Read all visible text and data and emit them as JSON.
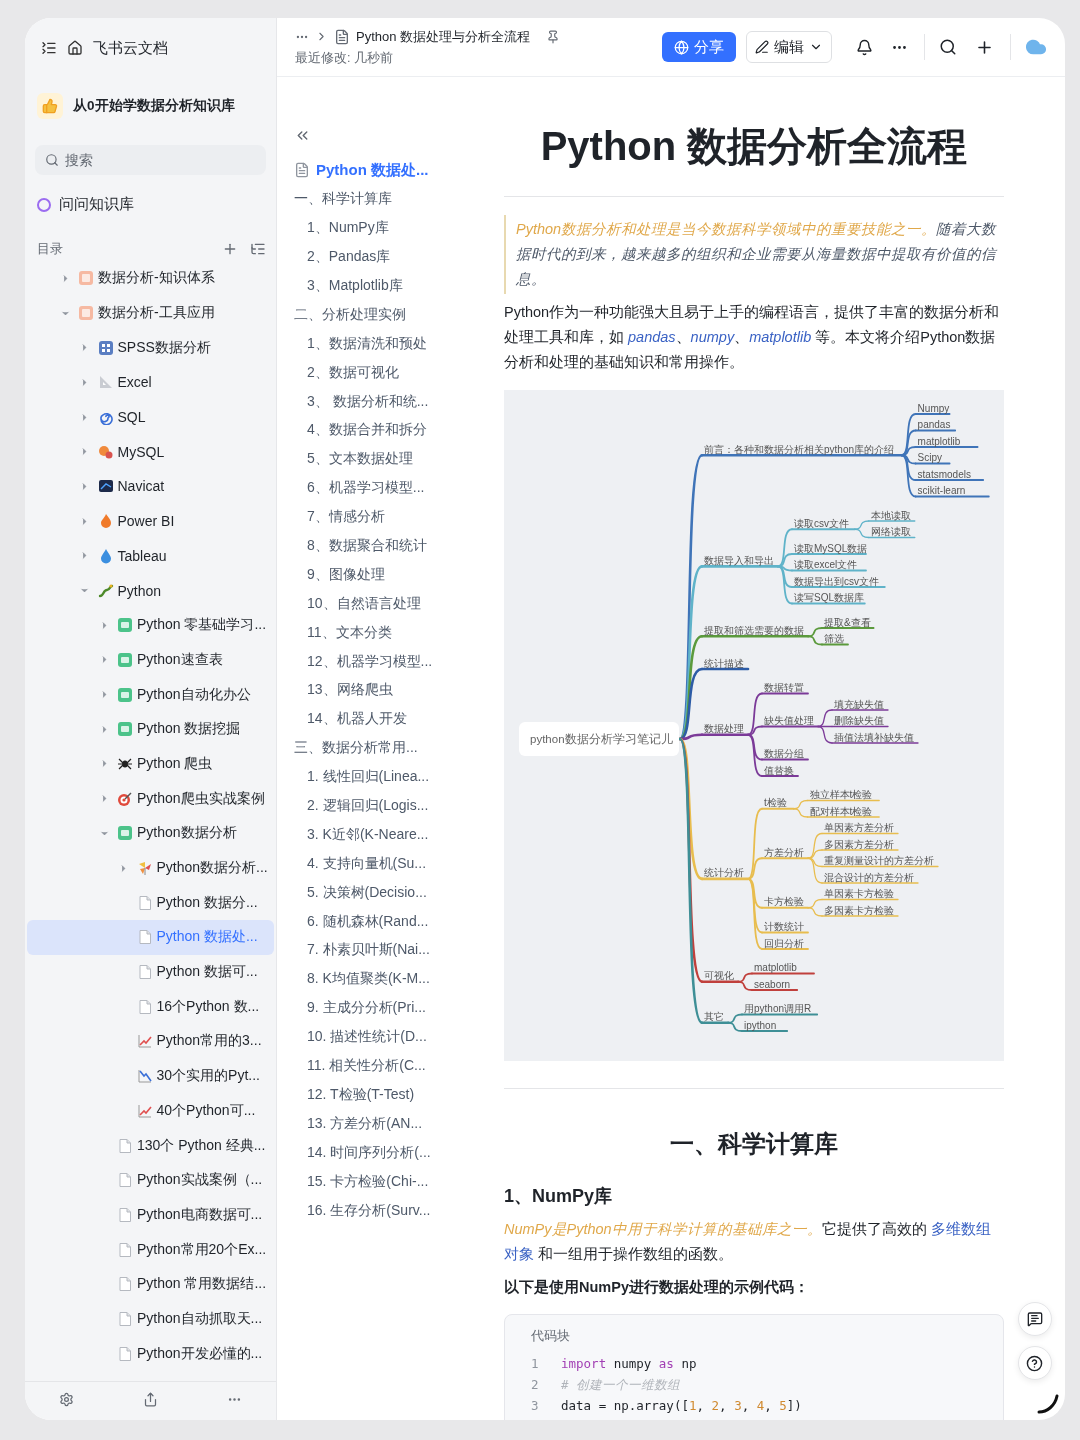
{
  "sidebar": {
    "app_title": "飞书云文档",
    "space": "从0开始学数据分析知识库",
    "search": {
      "placeholder": "搜索"
    },
    "ask": "问问知识库",
    "tree_label": "目录",
    "items": [
      {
        "label": "数据分析-知识体系",
        "kind": "wiki",
        "selected": false,
        "expanded": false
      },
      {
        "label": "数据分析-工具应用",
        "kind": "wiki",
        "selected": false,
        "expanded": true,
        "children": [
          {
            "label": "SPSS数据分析",
            "kind": "spss",
            "selected": false,
            "expanded": false
          },
          {
            "label": "Excel",
            "kind": "excel",
            "selected": false,
            "expanded": false
          },
          {
            "label": "SQL",
            "kind": "sql",
            "selected": false,
            "expanded": false
          },
          {
            "label": "MySQL",
            "kind": "mysql",
            "selected": false,
            "expanded": false
          },
          {
            "label": "Navicat",
            "kind": "navicat",
            "selected": false,
            "expanded": false
          },
          {
            "label": "Power BI",
            "kind": "powerbi",
            "selected": false,
            "expanded": false
          },
          {
            "label": "Tableau",
            "kind": "tableau",
            "selected": false,
            "expanded": false
          },
          {
            "label": "Python",
            "kind": "python",
            "selected": false,
            "expanded": true,
            "children": [
              {
                "label": "Python 零基础学习...",
                "kind": "sheet",
                "selected": false,
                "expanded": false
              },
              {
                "label": "Python速查表",
                "kind": "sheet",
                "selected": false,
                "expanded": false
              },
              {
                "label": "Python自动化办公",
                "kind": "sheet",
                "selected": false,
                "expanded": false
              },
              {
                "label": "Python 数据挖掘",
                "kind": "sheet",
                "selected": false,
                "expanded": false
              },
              {
                "label": "Python 爬虫",
                "kind": "spider",
                "selected": false,
                "expanded": false
              },
              {
                "label": "Python爬虫实战案例",
                "kind": "target",
                "selected": false,
                "expanded": false
              },
              {
                "label": "Python数据分析",
                "kind": "sheet",
                "selected": false,
                "expanded": true,
                "children": [
                  {
                    "label": "Python数据分析...",
                    "kind": "pinwheel",
                    "selected": false,
                    "expanded": false
                  },
                  {
                    "label": "Python 数据分...",
                    "kind": "doc",
                    "selected": false
                  },
                  {
                    "label": "Python 数据处...",
                    "kind": "doc",
                    "selected": true
                  },
                  {
                    "label": "Python 数据可...",
                    "kind": "doc",
                    "selected": false
                  },
                  {
                    "label": "16个Python 数...",
                    "kind": "doc",
                    "selected": false
                  },
                  {
                    "label": "Python常用的3...",
                    "kind": "chart",
                    "selected": false
                  },
                  {
                    "label": "30个实用的Pyt...",
                    "kind": "chart-down",
                    "selected": false
                  },
                  {
                    "label": "40个Python可...",
                    "kind": "chart",
                    "selected": false
                  }
                ]
              },
              {
                "label": "130个 Python 经典...",
                "kind": "doc",
                "selected": false
              },
              {
                "label": "Python实战案例（...",
                "kind": "doc",
                "selected": false
              },
              {
                "label": "Python电商数据可...",
                "kind": "doc",
                "selected": false
              },
              {
                "label": "Python常用20个Ex...",
                "kind": "doc",
                "selected": false
              },
              {
                "label": "Python 常用数据结...",
                "kind": "doc",
                "selected": false
              },
              {
                "label": "Python自动抓取天...",
                "kind": "doc",
                "selected": false
              },
              {
                "label": "Python开发必懂的...",
                "kind": "doc",
                "selected": false
              }
            ]
          }
        ]
      }
    ]
  },
  "header": {
    "breadcrumb": "Python 数据处理与分析全流程",
    "modified": "最近修改: 几秒前",
    "share": "分享",
    "edit": "编辑"
  },
  "toc": {
    "title": "Python 数据处...",
    "sections": [
      {
        "text": "一、科学计算库",
        "children": [
          {
            "text": "1、NumPy库"
          },
          {
            "text": "2、Pandas库"
          },
          {
            "text": "3、Matplotlib库"
          }
        ]
      },
      {
        "text": "二、分析处理实例",
        "children": [
          {
            "text": "1、数据清洗和预处"
          },
          {
            "text": "2、数据可视化"
          },
          {
            "text": "3、 数据分析和统..."
          },
          {
            "text": "4、数据合并和拆分"
          },
          {
            "text": "5、文本数据处理"
          },
          {
            "text": "6、机器学习模型..."
          },
          {
            "text": "7、情感分析"
          },
          {
            "text": "8、数据聚合和统计"
          },
          {
            "text": "9、图像处理"
          },
          {
            "text": "10、自然语言处理"
          },
          {
            "text": "11、文本分类"
          },
          {
            "text": "12、机器学习模型..."
          },
          {
            "text": "13、网络爬虫"
          },
          {
            "text": "14、机器人开发"
          }
        ]
      },
      {
        "text": "三、数据分析常用...",
        "children": [
          {
            "text": "1. 线性回归(Linea..."
          },
          {
            "text": "2. 逻辑回归(Logis..."
          },
          {
            "text": "3. K近邻(K-Neare..."
          },
          {
            "text": "4. 支持向量机(Su..."
          },
          {
            "text": "5. 决策树(Decisio..."
          },
          {
            "text": "6. 随机森林(Rand..."
          },
          {
            "text": "7. 朴素贝叶斯(Nai..."
          },
          {
            "text": "8. K均值聚类(K-M..."
          },
          {
            "text": "9. 主成分分析(Pri..."
          },
          {
            "text": "10. 描述性统计(D..."
          },
          {
            "text": "11. 相关性分析(C..."
          },
          {
            "text": "12. T检验(T-Test)"
          },
          {
            "text": "13. 方差分析(AN..."
          },
          {
            "text": "14. 时间序列分析(..."
          },
          {
            "text": "15. 卡方检验(Chi-..."
          },
          {
            "text": "16. 生存分析(Surv..."
          }
        ]
      }
    ]
  },
  "doc": {
    "title": "Python 数据分析全流程",
    "quote": [
      {
        "text": "Python数据分析和处理是当今数据科学领域中的重要技能之一。",
        "kind": "accent"
      },
      {
        "text": "随着大数据时代的到来，越来越多的组织和企业需要从海量数据中提取有价值的信息。",
        "kind": "italic"
      }
    ],
    "intro": [
      {
        "text": "Python作为一种功能强大且易于上手的编程语言，提供了丰富的数据分析和处理工具和库，如 ",
        "kind": "plain"
      },
      {
        "text": "pandas",
        "kind": "link-italic"
      },
      {
        "text": "、",
        "kind": "plain"
      },
      {
        "text": "numpy",
        "kind": "link-italic"
      },
      {
        "text": "、",
        "kind": "plain"
      },
      {
        "text": "matplotlib",
        "kind": "link-italic"
      },
      {
        "text": " 等。本文将介绍Python数据分析和处理的基础知识和常用操作。",
        "kind": "plain"
      }
    ],
    "mindmap": {
      "root": "python数据分析学习笔记儿",
      "branches": [
        {
          "text": "前言：各种和数据分析相关python库的介绍",
          "color": "#3f74b8",
          "children": [
            {
              "text": "Numpy"
            },
            {
              "text": "pandas"
            },
            {
              "text": "matplotlib"
            },
            {
              "text": "Scipy"
            },
            {
              "text": "statsmodels"
            },
            {
              "text": "scikit-learn"
            }
          ]
        },
        {
          "text": "数据导入和导出",
          "color": "#5fb3c9",
          "children": [
            {
              "text": "读取csv文件",
              "children": [
                {
                  "text": "本地读取"
                },
                {
                  "text": "网络读取"
                }
              ]
            },
            {
              "text": "读取MySQL数据"
            },
            {
              "text": "读取excel文件"
            },
            {
              "text": "数据导出到csv文件"
            },
            {
              "text": "读写SQL数据库"
            }
          ]
        },
        {
          "text": "提取和筛选需要的数据",
          "color": "#5b9a3c",
          "children": [
            {
              "text": "提取&查看"
            },
            {
              "text": "筛选"
            }
          ]
        },
        {
          "text": "统计描述",
          "color": "#2d5ca6"
        },
        {
          "text": "数据处理",
          "color": "#7b3a98",
          "children": [
            {
              "text": "数据转置"
            },
            {
              "text": "缺失值处理",
              "children": [
                {
                  "text": "填充缺失值"
                },
                {
                  "text": "删除缺失值"
                },
                {
                  "text": "插值法填补缺失值"
                }
              ]
            },
            {
              "text": "数据分组"
            },
            {
              "text": "值替换"
            }
          ]
        },
        {
          "text": "统计分析",
          "color": "#e8bd4e",
          "children": [
            {
              "text": "t检验",
              "children": [
                {
                  "text": "独立样本t检验"
                },
                {
                  "text": "配对样本t检验"
                }
              ]
            },
            {
              "text": "方差分析",
              "children": [
                {
                  "text": "单因素方差分析"
                },
                {
                  "text": "多因素方差分析"
                },
                {
                  "text": "重复测量设计的方差分析"
                },
                {
                  "text": "混合设计的方差分析"
                }
              ]
            },
            {
              "text": "卡方检验",
              "children": [
                {
                  "text": "单因素卡方检验"
                },
                {
                  "text": "多因素卡方检验"
                }
              ]
            },
            {
              "text": "计数统计"
            },
            {
              "text": "回归分析"
            }
          ]
        },
        {
          "text": "可视化",
          "color": "#c0403c",
          "children": [
            {
              "text": "matplotlib"
            },
            {
              "text": "seaborn"
            }
          ]
        },
        {
          "text": "其它",
          "color": "#3e8f96",
          "children": [
            {
              "text": "用python调用R"
            },
            {
              "text": "ipython"
            }
          ]
        }
      ]
    },
    "section_heading": "一、科学计算库",
    "subheading": "1、NumPy库",
    "paragraph": [
      {
        "text": "NumPy是Python中用于科学计算的基础库之一。",
        "kind": "accent"
      },
      {
        "text": "它提供了高效的 ",
        "kind": "plain"
      },
      {
        "text": "多维数组对象",
        "kind": "link"
      },
      {
        "text": " 和一组用于操作数组的函数。",
        "kind": "plain"
      }
    ],
    "code_intro": "以下是使用NumPy进行数据处理的示例代码：",
    "code": {
      "label": "代码块",
      "lines": [
        {
          "number": "1",
          "tokens": [
            {
              "text": "import",
              "kind": "keyword"
            },
            {
              "text": " numpy ",
              "kind": "plain"
            },
            {
              "text": "as",
              "kind": "keyword"
            },
            {
              "text": " np",
              "kind": "plain"
            }
          ]
        },
        {
          "number": "2",
          "tokens": [
            {
              "text": "# 创建一个一维数组",
              "kind": "comment"
            }
          ]
        },
        {
          "number": "3",
          "tokens": [
            {
              "text": "data = np.array([",
              "kind": "plain"
            },
            {
              "text": "1",
              "kind": "number"
            },
            {
              "text": ", ",
              "kind": "plain"
            },
            {
              "text": "2",
              "kind": "number"
            },
            {
              "text": ", ",
              "kind": "plain"
            },
            {
              "text": "3",
              "kind": "number"
            },
            {
              "text": ", ",
              "kind": "plain"
            },
            {
              "text": "4",
              "kind": "number"
            },
            {
              "text": ", ",
              "kind": "plain"
            },
            {
              "text": "5",
              "kind": "number"
            },
            {
              "text": "])",
              "kind": "plain"
            }
          ]
        }
      ]
    }
  }
}
